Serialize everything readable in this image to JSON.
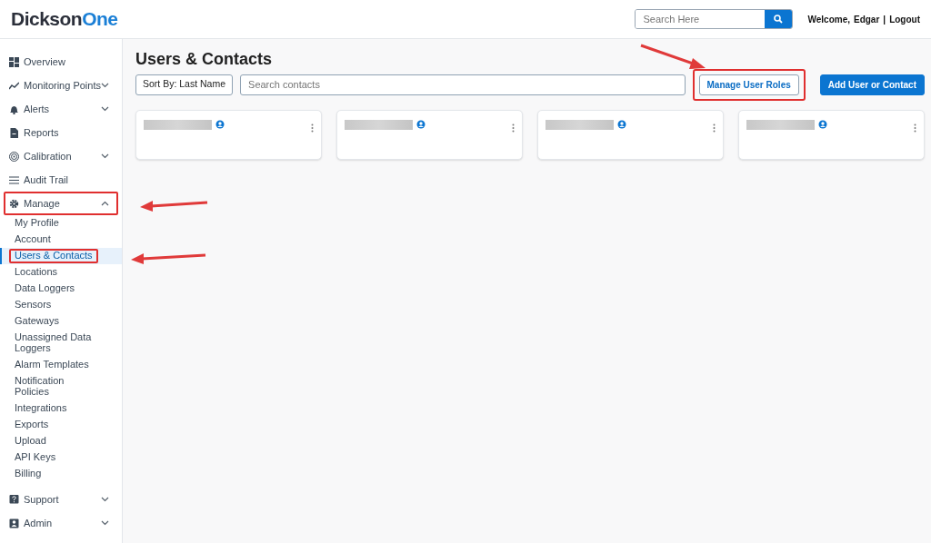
{
  "header": {
    "logo_first": "Dickson",
    "logo_second": "One",
    "search": {
      "placeholder": "Search Here"
    },
    "welcome": "Welcome,",
    "user": "Edgar",
    "separator": "|",
    "logout": "Logout"
  },
  "sidebar": {
    "items": [
      {
        "label": "Overview",
        "highlighted": false
      },
      {
        "label": "Monitoring Points",
        "expanded": false,
        "highlighted": false
      },
      {
        "label": "Alerts",
        "expanded": false,
        "highlighted": false
      },
      {
        "label": "Reports",
        "highlighted": false
      },
      {
        "label": "Calibration",
        "expanded": false,
        "highlighted": false
      },
      {
        "label": "Audit Trail",
        "highlighted": false
      },
      {
        "label": "Manage",
        "expanded": true,
        "highlighted": true,
        "children": [
          {
            "label": "My Profile",
            "selected": false,
            "highlighted": false
          },
          {
            "label": "Account",
            "selected": false,
            "highlighted": false
          },
          {
            "label": "Users & Contacts",
            "selected": true,
            "highlighted": true
          },
          {
            "label": "Locations",
            "selected": false,
            "highlighted": false
          },
          {
            "label": "Data Loggers",
            "selected": false,
            "highlighted": false
          },
          {
            "label": "Sensors",
            "selected": false,
            "highlighted": false
          },
          {
            "label": "Gateways",
            "selected": false,
            "highlighted": false
          },
          {
            "label": "Unassigned Data Loggers",
            "selected": false,
            "highlighted": false
          },
          {
            "label": "Alarm Templates",
            "selected": false,
            "highlighted": false
          },
          {
            "label": "Notification Policies",
            "selected": false,
            "highlighted": false
          },
          {
            "label": "Integrations",
            "selected": false,
            "highlighted": false
          },
          {
            "label": "Exports",
            "selected": false,
            "highlighted": false
          },
          {
            "label": "Upload",
            "selected": false,
            "highlighted": false
          },
          {
            "label": "API Keys",
            "selected": false,
            "highlighted": false
          },
          {
            "label": "Billing",
            "selected": false,
            "highlighted": false
          }
        ]
      },
      {
        "label": "Support",
        "expanded": false,
        "highlighted": false
      },
      {
        "label": "Admin",
        "expanded": false,
        "highlighted": false
      }
    ]
  },
  "page": {
    "title": "Users & Contacts",
    "sort_button": "Sort By: Last Name",
    "search": {
      "placeholder": "Search contacts"
    },
    "buttons": [
      {
        "label": "Manage User Roles",
        "kind": "outline",
        "highlighted": true
      },
      {
        "label": "Add User or Contact",
        "kind": "primary",
        "highlighted": false
      }
    ],
    "cards": [
      {
        "kind": "contact"
      },
      {
        "kind": "contact"
      },
      {
        "kind": "contact"
      },
      {
        "kind": "contact"
      }
    ]
  }
}
